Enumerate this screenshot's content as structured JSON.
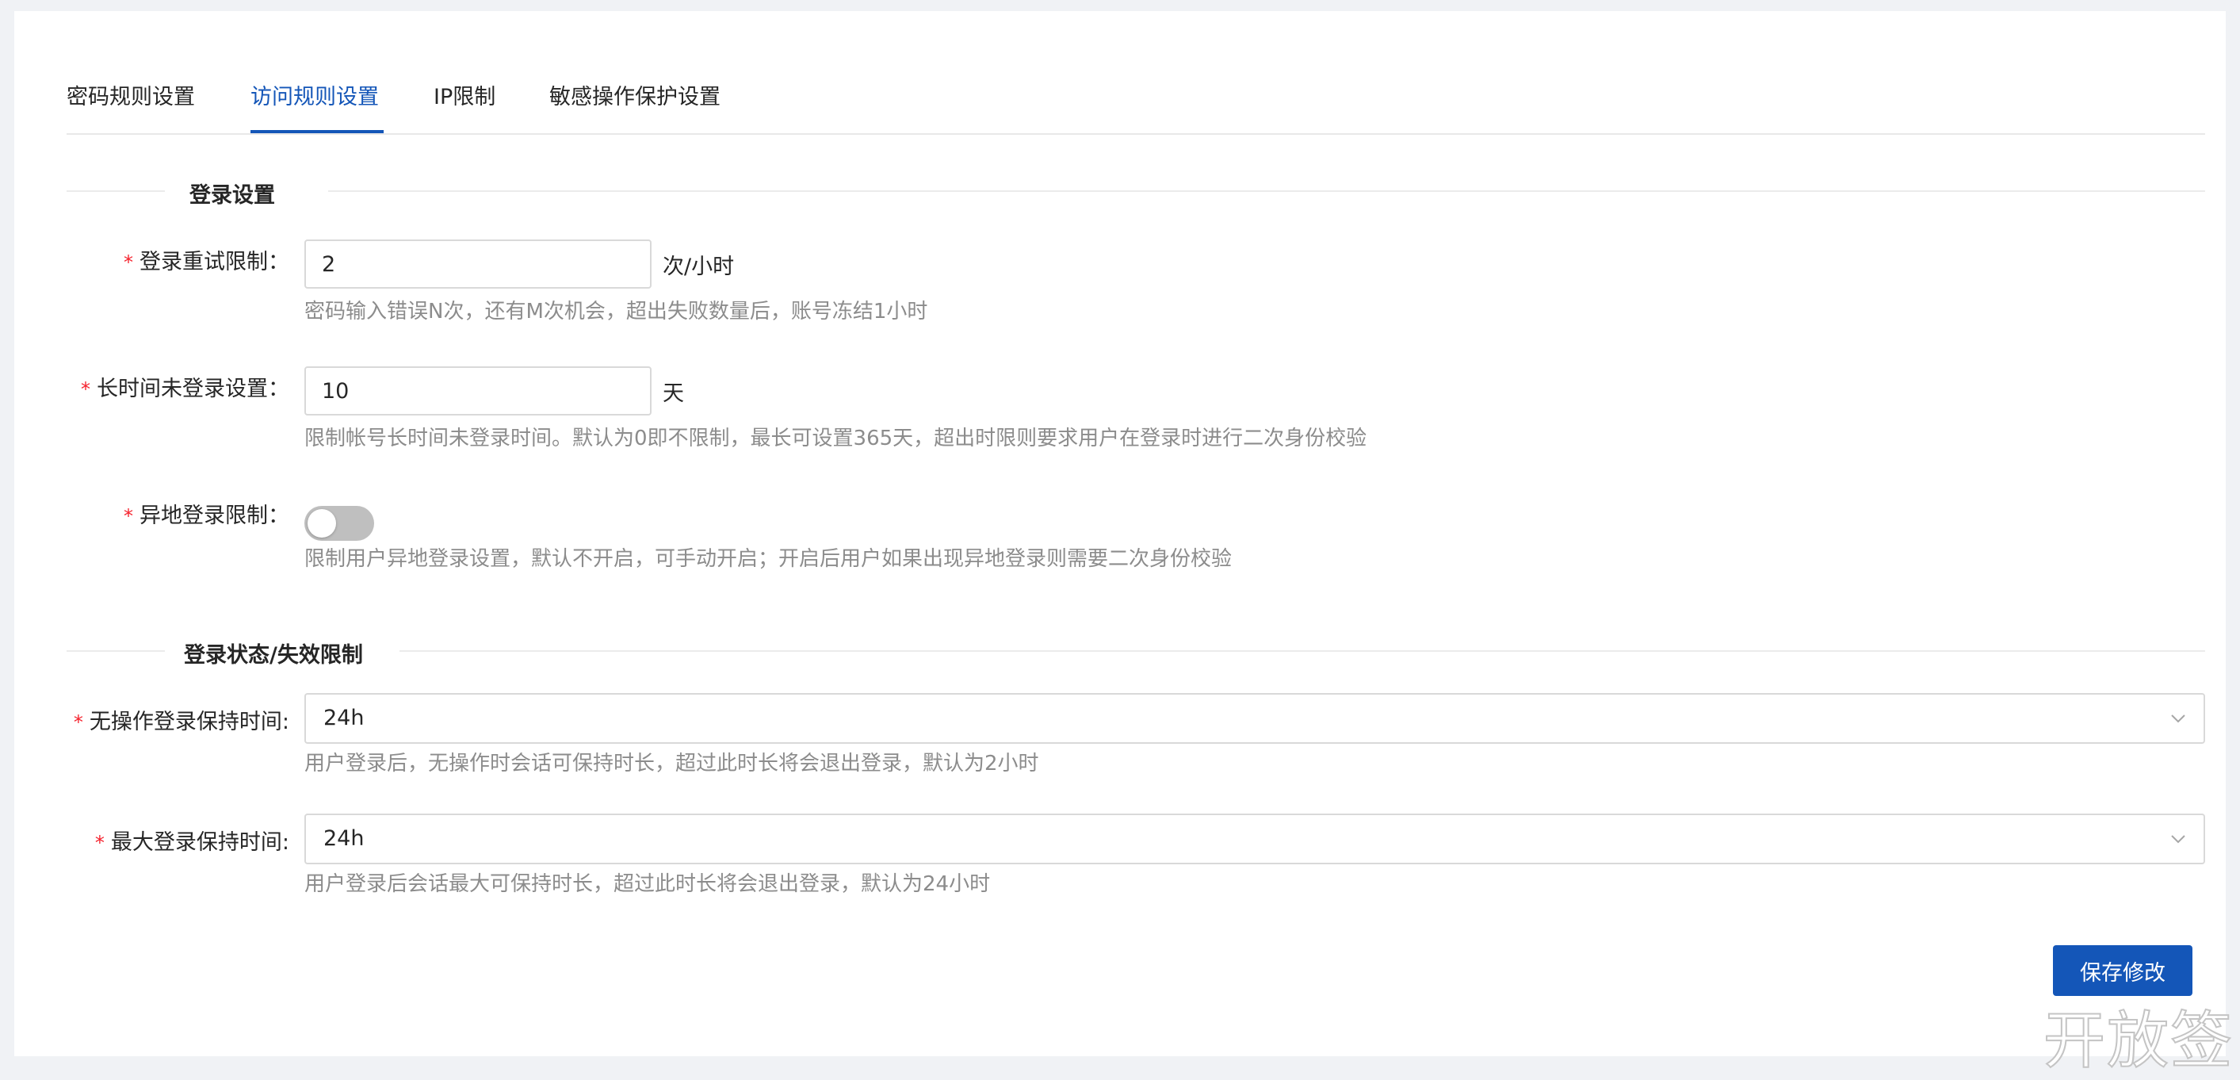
{
  "tabs": [
    {
      "label": "密码规则设置",
      "active": false
    },
    {
      "label": "访问规则设置",
      "active": true
    },
    {
      "label": "IP限制",
      "active": false
    },
    {
      "label": "敏感操作保护设置",
      "active": false
    }
  ],
  "login_settings": {
    "title": "登录设置",
    "retry_limit": {
      "label": "登录重试限制：",
      "value": "2",
      "unit": "次/小时",
      "help": "密码输入错误N次，还有M次机会，超出失败数量后，账号冻结1小时"
    },
    "inactive_limit": {
      "label": "长时间未登录设置：",
      "value": "10",
      "unit": "天",
      "help": "限制帐号长时间未登录时间。默认为0即不限制，最长可设置365天，超出时限则要求用户在登录时进行二次身份校验"
    },
    "remote_login": {
      "label": "异地登录限制：",
      "enabled": false,
      "help": "限制用户异地登录设置，默认不开启，可手动开启；开启后用户如果出现异地登录则需要二次身份校验"
    }
  },
  "session_settings": {
    "title": "登录状态/失效限制",
    "idle_timeout": {
      "label": "无操作登录保持时间:",
      "value": "24h",
      "help": "用户登录后，无操作时会话可保持时长，超过此时长将会退出登录，默认为2小时"
    },
    "max_session": {
      "label": "最大登录保持时间:",
      "value": "24h",
      "help": "用户登录后会话最大可保持时长，超过此时长将会退出登录，默认为24小时"
    }
  },
  "required_mark": "*",
  "save_button": "保存修改",
  "watermark": "开放签",
  "colors": {
    "accent": "#1456b8",
    "required": "#f5222d",
    "help_text": "#8c8c8c",
    "border": "#d9d9d9",
    "switch_off": "#bfbfbf"
  }
}
